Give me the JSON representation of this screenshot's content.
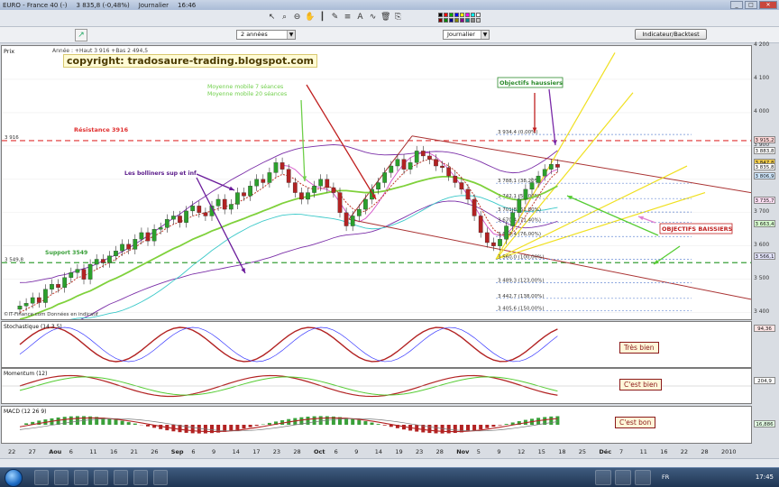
{
  "window": {
    "title": "EURO - France 40 (-)",
    "price": "3 835,8 (-0,48%)",
    "period": "Journalier",
    "time": "16:46"
  },
  "toolbar": {
    "range_value": "2 années",
    "period_value": "Journalier",
    "indicator_button": "Indicateur/Backtest"
  },
  "colors": {
    "resistance": "#e03030",
    "support": "#3aa03a",
    "bullish_candle": "#2ca02c",
    "bearish_candle": "#b22222",
    "bollinger": "#7b2fa8",
    "ma7": "#c0392b",
    "ma20": "#7fd13b"
  },
  "icons": [
    "cursor-icon",
    "zoom-icon",
    "zoom-out-icon",
    "hand-icon",
    "vline-icon",
    "pen-icon",
    "fib-icon",
    "text-icon",
    "cycle-icon",
    "trash-icon",
    "copy-icon"
  ],
  "main_panel": {
    "label": "Prix",
    "header_info": "Année : +Haut 3 916 +Bas 2 494,5",
    "copyright": "copyright: tradosaure-trading.blogspot.com",
    "source": "©IT-Finance.com Données en indicatif",
    "annotations": {
      "mm7": "Moyenne mobile 7 séances",
      "mm20": "Moyenne mobile 20 séances",
      "resistance": "Résistance 3916",
      "bollinger": "Les bolliners sup et inf",
      "support": "Support 3549",
      "objectifs_haussiers": "Objectifs haussiers",
      "objectifs_baissiers": "OBJECTIFS BAISSIERS"
    },
    "resistance_value": "3 916",
    "support_value": "3 549,8",
    "fib_labels": [
      "3 934,4 (0,00%)",
      "3 788,1 (38,20%)",
      "3 742,1 (50,00%)",
      "3 701,8 (61,80%)",
      "3 670,4 (71,40%)",
      "3 628,4 (76,00%)",
      "3 560,0 (100,00%)",
      "3 489,3 (123,00%)",
      "3 442,7 (138,00%)",
      "3 405,6 (150,00%)"
    ],
    "price_boxes": [
      "3 915,2",
      "3 883,8",
      "3 847,8",
      "3 835,8",
      "3 806,9",
      "3 735,7",
      "3 663,4",
      "3 566,1"
    ]
  },
  "chart_data": {
    "type": "candlestick",
    "ylim": [
      3380,
      4200
    ],
    "y_ticks": [
      4200,
      4100,
      4000,
      3900,
      3800,
      3700,
      3600,
      3500,
      3400
    ],
    "y_tick_labels": [
      "4 200",
      "4 100",
      "4 000",
      "3 900",
      "3 800",
      "3 700",
      "3 600",
      "3 500",
      "3 400"
    ],
    "x_tick_labels": [
      "22",
      "27",
      "Aou",
      "6",
      "11",
      "16",
      "21",
      "26",
      "Sep",
      "6",
      "9",
      "14",
      "17",
      "23",
      "28",
      "Oct",
      "6",
      "9",
      "14",
      "19",
      "23",
      "28",
      "Nov",
      "5",
      "9",
      "12",
      "15",
      "18",
      "25",
      "Déc",
      "7",
      "11",
      "16",
      "22",
      "28",
      "2010"
    ],
    "closes": [
      3420,
      3428,
      3445,
      3430,
      3470,
      3485,
      3475,
      3505,
      3520,
      3530,
      3500,
      3545,
      3560,
      3550,
      3570,
      3585,
      3605,
      3590,
      3620,
      3640,
      3615,
      3650,
      3655,
      3680,
      3690,
      3670,
      3705,
      3720,
      3700,
      3690,
      3720,
      3740,
      3710,
      3725,
      3760,
      3750,
      3780,
      3800,
      3790,
      3820,
      3850,
      3830,
      3790,
      3760,
      3740,
      3760,
      3780,
      3800,
      3775,
      3760,
      3700,
      3660,
      3690,
      3710,
      3740,
      3770,
      3790,
      3820,
      3840,
      3860,
      3830,
      3850,
      3885,
      3870,
      3860,
      3840,
      3835,
      3810,
      3790,
      3770,
      3740,
      3690,
      3640,
      3610,
      3600,
      3620,
      3660,
      3700,
      3740,
      3770,
      3790,
      3810,
      3830,
      3845,
      3836
    ],
    "opens": [
      3410,
      3420,
      3428,
      3445,
      3430,
      3470,
      3485,
      3475,
      3505,
      3520,
      3530,
      3500,
      3545,
      3560,
      3550,
      3570,
      3585,
      3605,
      3590,
      3620,
      3640,
      3615,
      3650,
      3655,
      3680,
      3690,
      3670,
      3705,
      3720,
      3700,
      3690,
      3720,
      3740,
      3710,
      3725,
      3760,
      3750,
      3780,
      3800,
      3790,
      3820,
      3850,
      3830,
      3790,
      3760,
      3740,
      3760,
      3780,
      3800,
      3775,
      3760,
      3700,
      3660,
      3690,
      3710,
      3740,
      3770,
      3790,
      3820,
      3840,
      3860,
      3830,
      3850,
      3885,
      3870,
      3860,
      3840,
      3835,
      3810,
      3790,
      3770,
      3740,
      3690,
      3640,
      3610,
      3600,
      3620,
      3660,
      3700,
      3740,
      3770,
      3790,
      3810,
      3830,
      3845
    ],
    "series": [
      {
        "name": "Moyenne mobile 7 séances",
        "values": [
          3400,
          3410,
          3420,
          3430,
          3440,
          3455,
          3465,
          3480,
          3490,
          3505,
          3510,
          3520,
          3530,
          3540,
          3550,
          3560,
          3575,
          3585,
          3595,
          3610,
          3620,
          3630,
          3640,
          3655,
          3665,
          3672,
          3680,
          3690,
          3695,
          3700,
          3705,
          3712,
          3718,
          3722,
          3730,
          3740,
          3750,
          3762,
          3775,
          3790,
          3805,
          3815,
          3810,
          3800,
          3785,
          3775,
          3770,
          3772,
          3778,
          3775,
          3755,
          3730,
          3712,
          3700,
          3705,
          3718,
          3735,
          3755,
          3780,
          3800,
          3820,
          3835,
          3845,
          3855,
          3860,
          3858,
          3850,
          3840,
          3825,
          3805,
          3780,
          3750,
          3715,
          3680,
          3650,
          3635,
          3630,
          3640,
          3660,
          3690,
          3720,
          3750,
          3780,
          3805,
          3822
        ]
      },
      {
        "name": "Moyenne mobile 20 séances",
        "values": [
          3380,
          3385,
          3392,
          3400,
          3408,
          3415,
          3425,
          3432,
          3440,
          3450,
          3458,
          3465,
          3475,
          3485,
          3495,
          3503,
          3512,
          3522,
          3532,
          3542,
          3552,
          3562,
          3572,
          3582,
          3592,
          3600,
          3610,
          3620,
          3628,
          3636,
          3645,
          3652,
          3660,
          3668,
          3675,
          3682,
          3690,
          3697,
          3705,
          3712,
          3720,
          3728,
          3734,
          3740,
          3745,
          3748,
          3752,
          3756,
          3760,
          3764,
          3766,
          3766,
          3764,
          3762,
          3760,
          3760,
          3762,
          3765,
          3770,
          3775,
          3780,
          3786,
          3792,
          3797,
          3802,
          3806,
          3808,
          3808,
          3806,
          3802,
          3796,
          3790,
          3782,
          3772,
          3762,
          3752,
          3745,
          3740,
          3738,
          3740,
          3745,
          3752,
          3760,
          3770,
          3780
        ]
      }
    ]
  },
  "subpanels": [
    {
      "label": "Stochastique (14 3 5)",
      "comment": "Très bien",
      "value_box": "94,36"
    },
    {
      "label": "Momentum (12)",
      "comment": "C'est bien",
      "value_box": "204,9"
    },
    {
      "label": "MACD (12 26 9)",
      "comment": "C'est bon",
      "value_box": "16,886"
    }
  ],
  "taskbar": {
    "lang": "FR",
    "clock": "17:45"
  }
}
